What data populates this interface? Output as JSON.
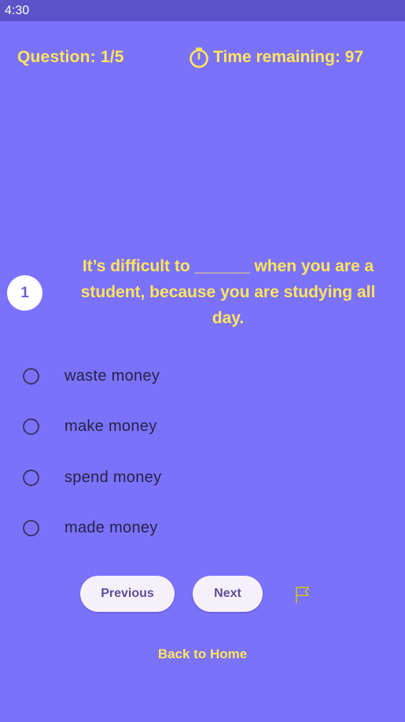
{
  "status_bar": {
    "time": "4:30"
  },
  "header": {
    "question_counter": "Question: 1/5",
    "timer_icon": "timer-icon",
    "time_remaining": "Time remaining: 97"
  },
  "question": {
    "number": "1",
    "text": "It’s difficult to  ______ when you are a student, because you are studying all day."
  },
  "options": [
    {
      "label": "waste money",
      "selected": false
    },
    {
      "label": "make money",
      "selected": false
    },
    {
      "label": "spend money",
      "selected": false
    },
    {
      "label": "made money",
      "selected": false
    }
  ],
  "nav": {
    "previous_label": "Previous",
    "next_label": "Next",
    "flag_icon": "flag-icon"
  },
  "back_home_label": "Back to Home",
  "colors": {
    "background": "#7b72fc",
    "status_bar": "#5b53c7",
    "accent_yellow": "#ffe55a",
    "button_bg": "#f6f0fb"
  }
}
